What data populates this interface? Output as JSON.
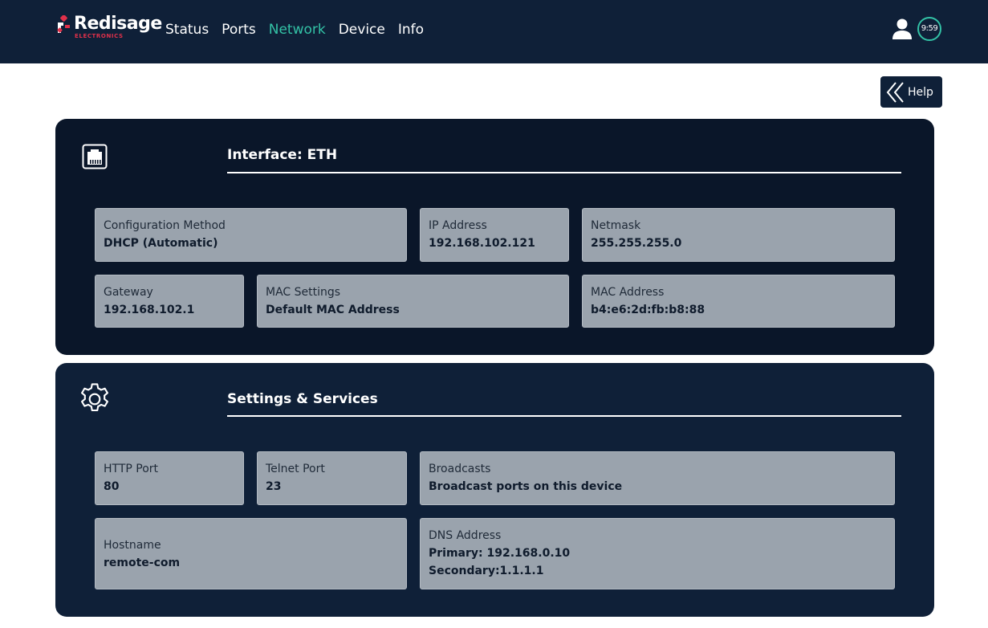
{
  "brand": {
    "name": "Redisage",
    "subtitle": "ELECTRONICS",
    "accent": "#e0304a"
  },
  "nav": {
    "items": [
      {
        "label": "Status"
      },
      {
        "label": "Ports"
      },
      {
        "label": "Network",
        "active": true
      },
      {
        "label": "Device"
      },
      {
        "label": "Info"
      }
    ],
    "active_color": "#33c2a6"
  },
  "header": {
    "user_icon": "user-icon",
    "timer": "9:59"
  },
  "help": {
    "label": "Help",
    "icon": "double-chevron-left-icon"
  },
  "interface_panel": {
    "icon": "ethernet-port-icon",
    "title": "Interface: ETH",
    "fields": {
      "config_method": {
        "label": "Configuration Method",
        "value": "DHCP (Automatic)"
      },
      "ip_address": {
        "label": "IP Address",
        "value": "192.168.102.121"
      },
      "netmask": {
        "label": "Netmask",
        "value": "255.255.255.0"
      },
      "gateway": {
        "label": "Gateway",
        "value": "192.168.102.1"
      },
      "mac_settings": {
        "label": "MAC Settings",
        "value": "Default MAC Address"
      },
      "mac_address": {
        "label": "MAC Address",
        "value": "b4:e6:2d:fb:b8:88"
      }
    }
  },
  "services_panel": {
    "icon": "gear-icon",
    "title": "Settings & Services",
    "fields": {
      "http_port": {
        "label": "HTTP Port",
        "value": "80"
      },
      "telnet_port": {
        "label": "Telnet Port",
        "value": "23"
      },
      "broadcasts": {
        "label": "Broadcasts",
        "value": "Broadcast ports on this device"
      },
      "hostname": {
        "label": "Hostname",
        "value": "remote-com"
      },
      "dns": {
        "label": "DNS Address",
        "primary": "Primary: 192.168.0.10",
        "secondary": "Secondary:1.1.1.1"
      }
    }
  }
}
